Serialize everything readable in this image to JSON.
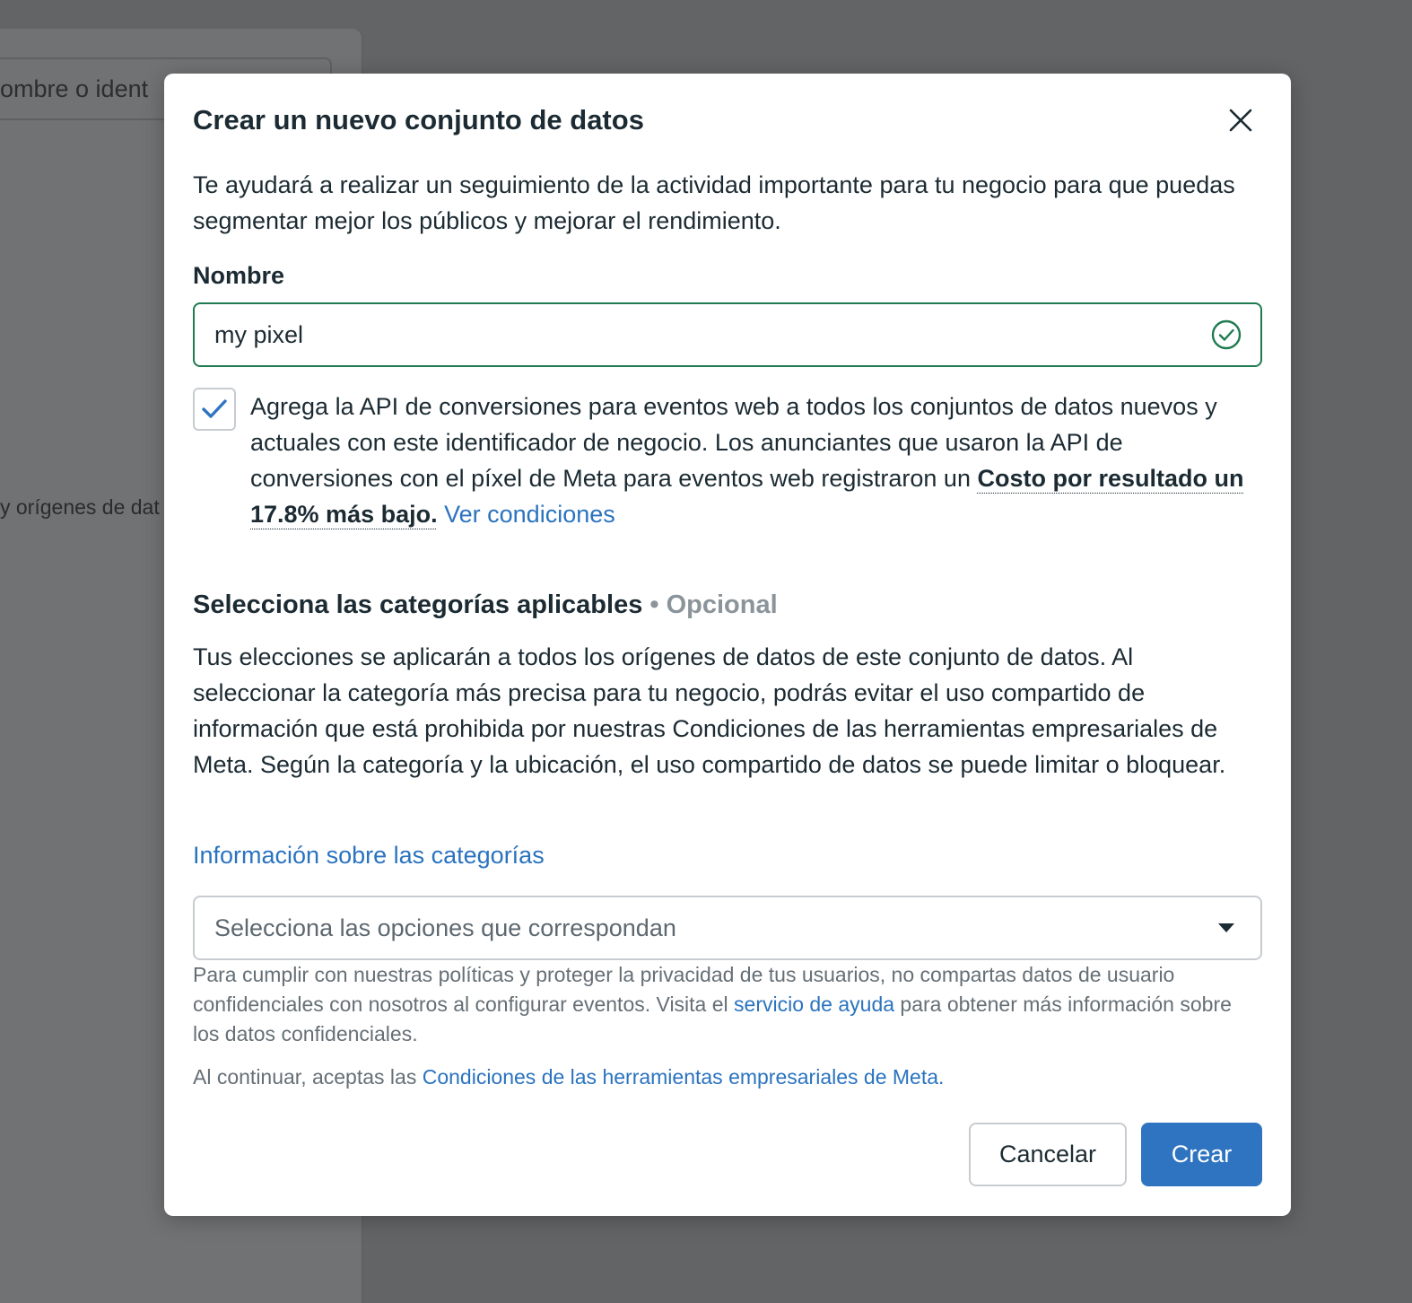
{
  "background": {
    "search_text": "ombre o ident",
    "side_label": "y orígenes de dat"
  },
  "modal": {
    "title": "Crear un nuevo conjunto de datos",
    "intro": "Te ayudará a realizar un seguimiento de la actividad importante para tu negocio para que puedas segmentar mejor los públicos y mejorar el rendimiento.",
    "name_label": "Nombre",
    "name_value": "my pixel",
    "api_checkbox": {
      "checked": true,
      "text": "Agrega la API de conversiones para eventos web a todos los conjuntos de datos nuevos y actuales con este identificador de negocio. Los anunciantes que usaron la API de conversiones con el píxel de Meta para eventos web registraron un ",
      "highlight": "Costo por resultado un 17.8% más bajo.",
      "link": "Ver condiciones"
    },
    "categories": {
      "title": "Selecciona las categorías aplicables",
      "optional": " • Opcional",
      "description": "Tus elecciones se aplicarán a todos los orígenes de datos de este conjunto de datos. Al seleccionar la categoría más precisa para tu negocio, podrás evitar el uso compartido de información que está prohibida por nuestras Condiciones de las herramientas empresariales de Meta. Según la categoría y la ubicación, el uso compartido de datos se puede limitar o bloquear.",
      "info_link": "Información sobre las categorías",
      "select_placeholder": "Selecciona las opciones que correspondan"
    },
    "privacy_note": {
      "before": "Para cumplir con nuestras políticas y proteger la privacidad de tus usuarios, no compartas datos de usuario confidenciales con nosotros al configurar eventos. Visita el ",
      "link": "servicio de ayuda",
      "after": " para obtener más información sobre los datos confidenciales."
    },
    "terms_note": {
      "before": "Al continuar, aceptas las ",
      "link": "Condiciones de las herramientas empresariales de Meta."
    },
    "buttons": {
      "cancel": "Cancelar",
      "create": "Crear"
    }
  },
  "colors": {
    "accent": "#2f74c0",
    "link": "#2a73bf",
    "valid": "#1e7b51"
  },
  "icons": {
    "close": "close-icon",
    "valid": "check-circle-icon",
    "checkbox": "checkmark-icon",
    "dropdown": "caret-down-icon"
  }
}
